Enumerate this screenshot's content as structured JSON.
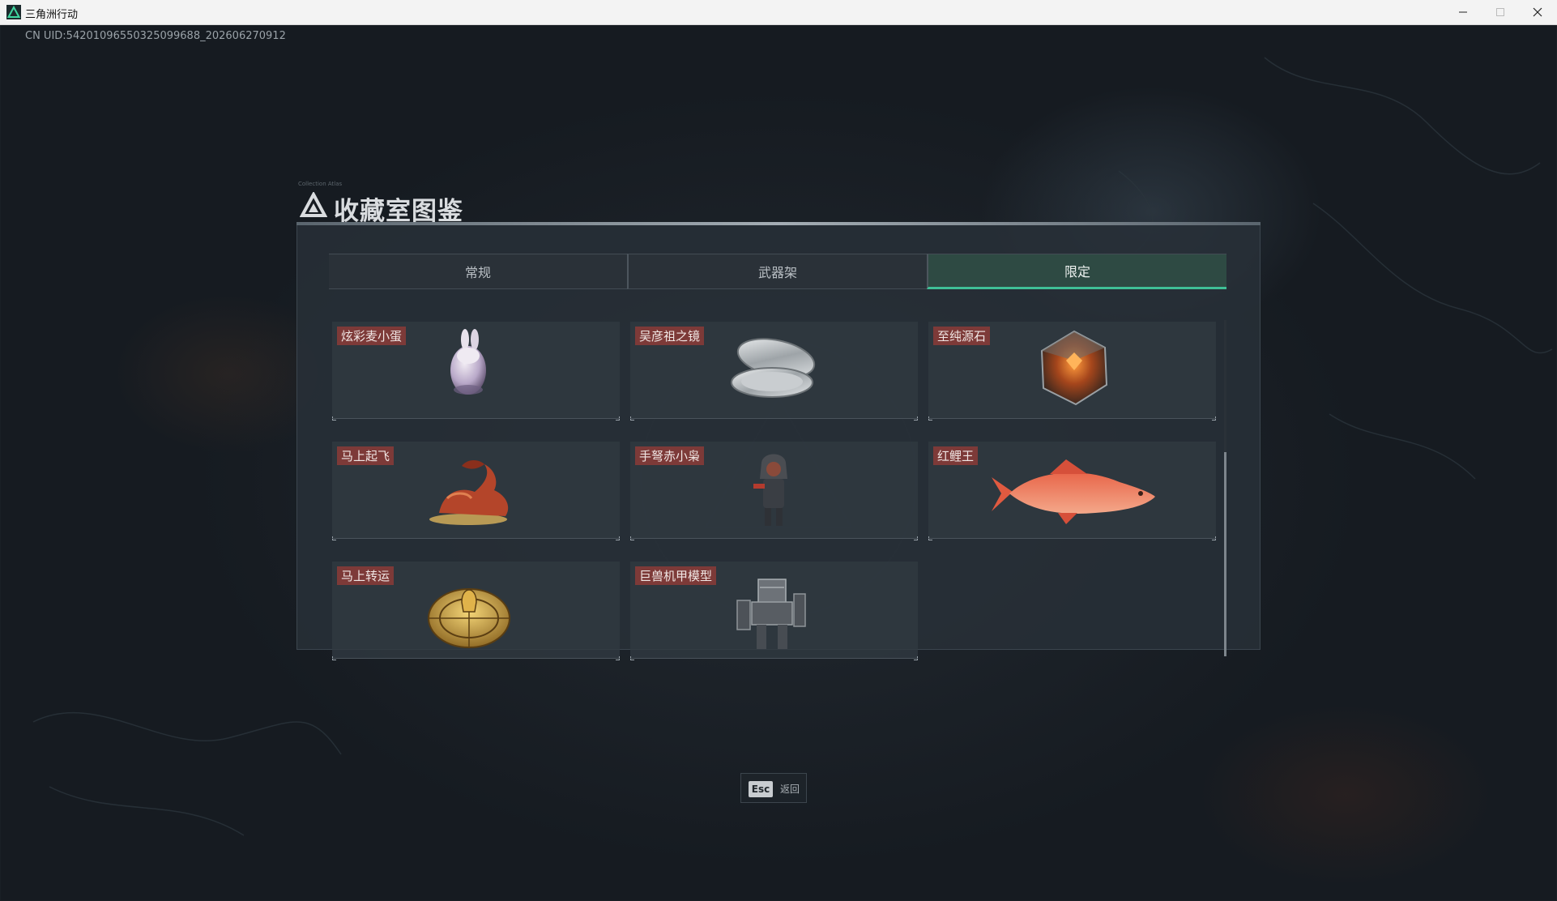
{
  "window": {
    "title": "三角洲行动",
    "minimize_icon": "minimize-icon",
    "maximize_icon": "maximize-icon",
    "close_icon": "close-icon"
  },
  "uid_text": "CN UID:54201096550325099688_202606270912",
  "page": {
    "title": "收藏室图鉴",
    "title_icon": "delta-triangle-logo",
    "deco_text": "Collection Atlas"
  },
  "tabs": [
    {
      "label": "常规",
      "active": false
    },
    {
      "label": "武器架",
      "active": false
    },
    {
      "label": "限定",
      "active": true
    }
  ],
  "items": [
    {
      "name": "炫彩麦小蛋",
      "icon": "rabbit-egg-icon"
    },
    {
      "name": "吴彦祖之镜",
      "icon": "silver-compact-mirror-icon"
    },
    {
      "name": "至纯源石",
      "icon": "glowing-cube-stone-icon"
    },
    {
      "name": "马上起飞",
      "icon": "red-horse-figurine-icon"
    },
    {
      "name": "手弩赤小枭",
      "icon": "hooded-crossbow-figure-icon"
    },
    {
      "name": "红鲤王",
      "icon": "red-carp-fish-icon"
    },
    {
      "name": "马上转运",
      "icon": "golden-fortune-wheel-icon"
    },
    {
      "name": "巨兽机甲模型",
      "icon": "mech-model-icon"
    }
  ],
  "footer": {
    "esc_key": "Esc",
    "esc_label": "返回"
  },
  "colors": {
    "label_bg": "#7d3a38",
    "active_tab_bg": "#2e4a43",
    "active_tab_accent": "#3fbf96",
    "background": "#1a2026"
  }
}
